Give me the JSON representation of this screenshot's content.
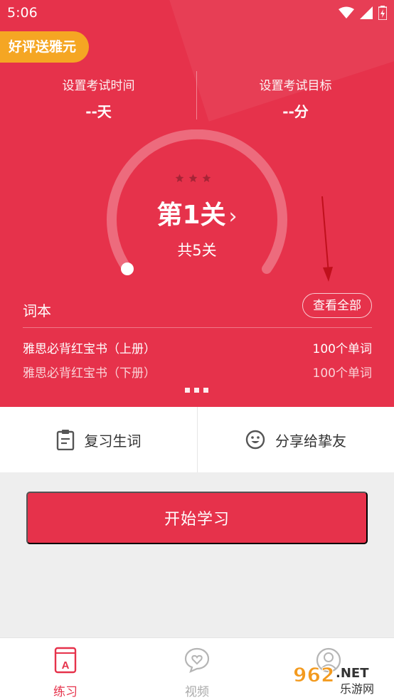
{
  "status_bar": {
    "time": "5:06"
  },
  "promo": {
    "label": "好评送雅元"
  },
  "settings": {
    "exam_time": {
      "label": "设置考试时间",
      "value": "--天"
    },
    "exam_goal": {
      "label": "设置考试目标",
      "value": "--分"
    }
  },
  "gauge": {
    "level_label": "第1关",
    "level_chevron": "›",
    "total_label": "共5关",
    "stars_earned": 0,
    "stars_total": 3,
    "progress_fraction": 0
  },
  "wordbook": {
    "title": "词本",
    "view_all": "查看全部",
    "books": [
      {
        "name": "雅思必背红宝书（上册）",
        "count": "100个单词"
      },
      {
        "name": "雅思必背红宝书（下册）",
        "count": "100个单词"
      }
    ]
  },
  "actions": {
    "review": "复习生词",
    "share": "分享给挚友"
  },
  "start_button": "开始学习",
  "tabbar": {
    "practice": "练习",
    "video": "视频",
    "me": ""
  },
  "watermark": {
    "text1": "962",
    "text2": ".NET",
    "text3": "乐游网"
  },
  "colors": {
    "accent": "#e6324b",
    "promo": "#f5a623",
    "annotation_arrow": "#c0101c"
  },
  "icons": {
    "review": "clipboard-icon",
    "share": "smiley-icon",
    "practice": "book-a-icon",
    "video": "heart-chat-icon",
    "me": "avatar-icon"
  }
}
